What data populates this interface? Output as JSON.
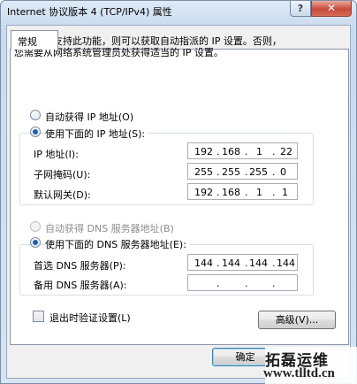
{
  "window": {
    "title": "Internet 协议版本 4 (TCP/IPv4) 属性",
    "help_glyph": "?",
    "close_glyph": "✕"
  },
  "tab": {
    "label": "常规"
  },
  "description": {
    "line1": "如果网络支持此功能，则可以获取自动指派的 IP 设置。否则，",
    "line2": "您需要从网络系统管理员处获得适当的 IP 设置。"
  },
  "ip": {
    "auto_label": "自动获得 IP 地址(O)",
    "manual_label": "使用下面的 IP 地址(S):",
    "address_label": "IP 地址(I):",
    "address": [
      "192",
      "168",
      "1",
      "22"
    ],
    "mask_label": "子网掩码(U):",
    "mask": [
      "255",
      "255",
      "255",
      "0"
    ],
    "gateway_label": "默认网关(D):",
    "gateway": [
      "192",
      "168",
      "1",
      "1"
    ]
  },
  "dns": {
    "auto_label": "自动获得 DNS 服务器地址(B)",
    "manual_label": "使用下面的 DNS 服务器地址(E):",
    "preferred_label": "首选 DNS 服务器(P):",
    "preferred": [
      "144",
      "144",
      "144",
      "144"
    ],
    "alternate_label": "备用 DNS 服务器(A):",
    "alternate": [
      "",
      "",
      "",
      ""
    ]
  },
  "validate_label": "退出时验证设置(L)",
  "advanced_label": "高级(V)...",
  "ok_label": "确定",
  "watermark": {
    "line1": "拓磊运维",
    "line2": "www.tlltd.cn"
  }
}
